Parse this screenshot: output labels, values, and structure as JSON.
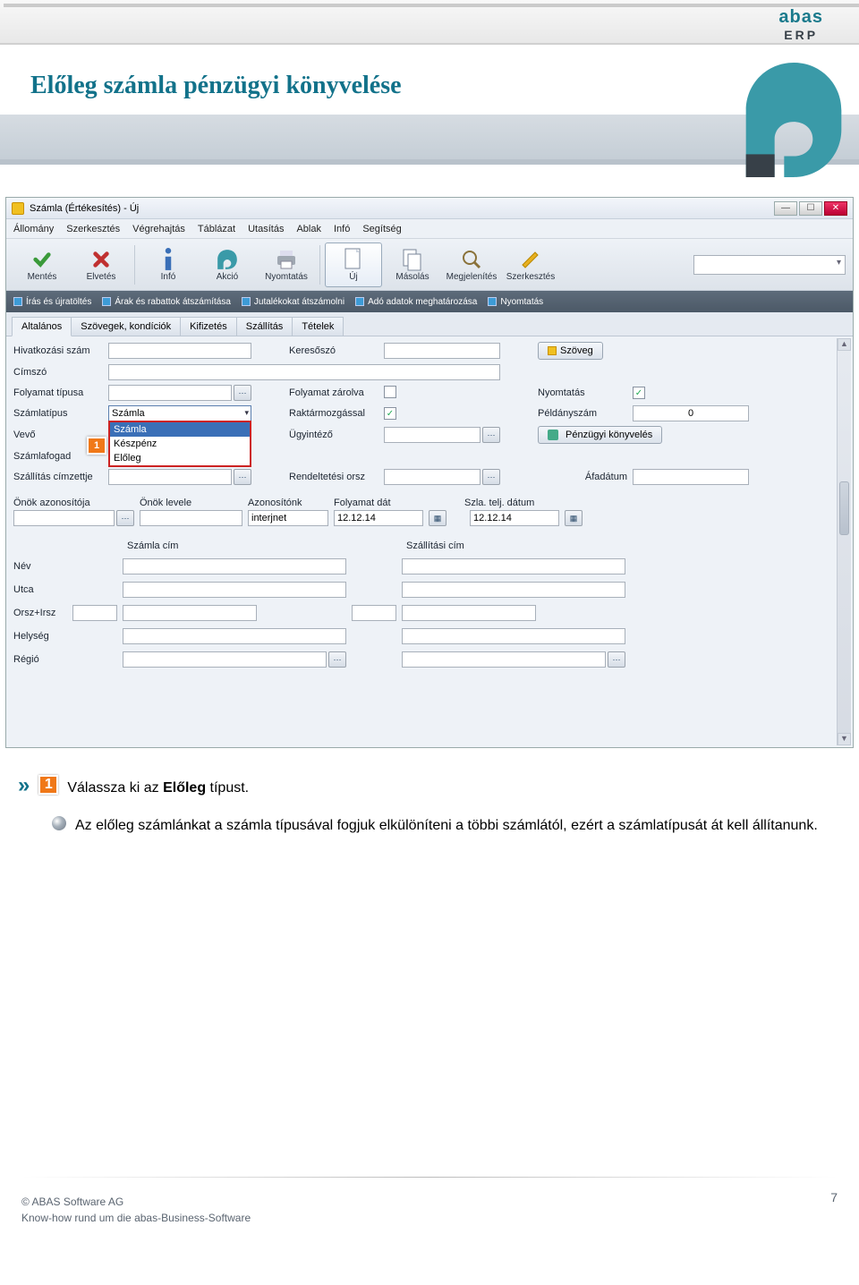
{
  "brand": {
    "name": "abas",
    "sub": "ERP"
  },
  "page_title": "Előleg számla pénzügyi könyvelése",
  "window": {
    "title": "Számla (Értékesítés) - Új",
    "menu": [
      "Állomány",
      "Szerkesztés",
      "Végrehajtás",
      "Táblázat",
      "Utasítás",
      "Ablak",
      "Infó",
      "Segítség"
    ],
    "toolbar": [
      {
        "id": "mentes",
        "label": "Mentés"
      },
      {
        "id": "elvetes",
        "label": "Elvetés"
      },
      {
        "id": "info",
        "label": "Infó"
      },
      {
        "id": "akcio",
        "label": "Akció"
      },
      {
        "id": "nyomtatas",
        "label": "Nyomtatás"
      },
      {
        "id": "uj",
        "label": "Új",
        "selected": true
      },
      {
        "id": "masolas",
        "label": "Másolás"
      },
      {
        "id": "megjelenites",
        "label": "Megjelenítés"
      },
      {
        "id": "szerkesztes",
        "label": "Szerkesztés"
      }
    ],
    "shortcuts": [
      "Írás és újratöltés",
      "Árak és rabattok átszámítása",
      "Jutalékokat átszámolni",
      "Adó adatok meghatározása",
      "Nyomtatás"
    ],
    "tabs": [
      "Altalános",
      "Szövegek, kondíciók",
      "Kifizetés",
      "Szállítás",
      "Tételek"
    ],
    "active_tab": 0,
    "form": {
      "hivatkozasi_szam": {
        "label": "Hivatkozási szám",
        "value": ""
      },
      "keresoszo": {
        "label": "Keresőszó",
        "value": ""
      },
      "szoveg_btn": "Szöveg",
      "cimszo": {
        "label": "Címszó",
        "value": ""
      },
      "folyamat_tipusa": {
        "label": "Folyamat típusa",
        "value": ""
      },
      "folyamat_zarolva": {
        "label": "Folyamat zárolva",
        "checked": false
      },
      "nyomtatas": {
        "label": "Nyomtatás",
        "checked": true
      },
      "szamlatipus": {
        "label": "Számlatípus",
        "value": "Számla",
        "options": [
          "Számla",
          "Készpénz",
          "Előleg"
        ]
      },
      "raktarmozgassal": {
        "label": "Raktármozgással",
        "checked": true
      },
      "peldanyszam": {
        "label": "Példányszám",
        "value": "0"
      },
      "vevo": {
        "label": "Vevő",
        "value": ""
      },
      "ugyintezo": {
        "label": "Ügyintéző",
        "value": ""
      },
      "penzugyi_btn": "Pénzügyi könyvelés",
      "szamlafogad": {
        "label": "Számlafogad",
        "value": ""
      },
      "szallitas_cimzettje": {
        "label": "Szállítás címzettje",
        "value": ""
      },
      "rendeltetesi_orsz": {
        "label": "Rendeltetési orsz",
        "value": ""
      },
      "afadatum": {
        "label": "Áfadátum",
        "value": ""
      },
      "onok_azonositoja": {
        "label": "Önök azonosítója",
        "value": ""
      },
      "onok_levele": {
        "label": "Önök levele",
        "value": ""
      },
      "azonositonk": {
        "label": "Azonosítónk",
        "value": "interjnet"
      },
      "folyamat_dat": {
        "label": "Folyamat dát",
        "value": "12.12.14"
      },
      "szla_telj_datum": {
        "label": "Szla. telj. dátum",
        "value": "12.12.14"
      },
      "addresses": {
        "col1": "Számla cím",
        "col2": "Szállítási cím",
        "rows": [
          "Név",
          "Utca",
          "Orsz+Irsz",
          "Helység",
          "Régió"
        ]
      }
    }
  },
  "instructions": {
    "step1": {
      "num": "1",
      "text_before": "Válassza  ki  az ",
      "bold": "Előleg",
      "text_after": "  típust."
    },
    "note": "Az előleg számlánkat a számla típusával fogjuk elkülöníteni a többi számlától, ezért a számlatípusát át  kell  állítanunk."
  },
  "footer": {
    "copyright": "©  ABAS  Software  AG",
    "tagline": "Know-how  rund  um  die  abas-Business-Software",
    "page": "7"
  }
}
